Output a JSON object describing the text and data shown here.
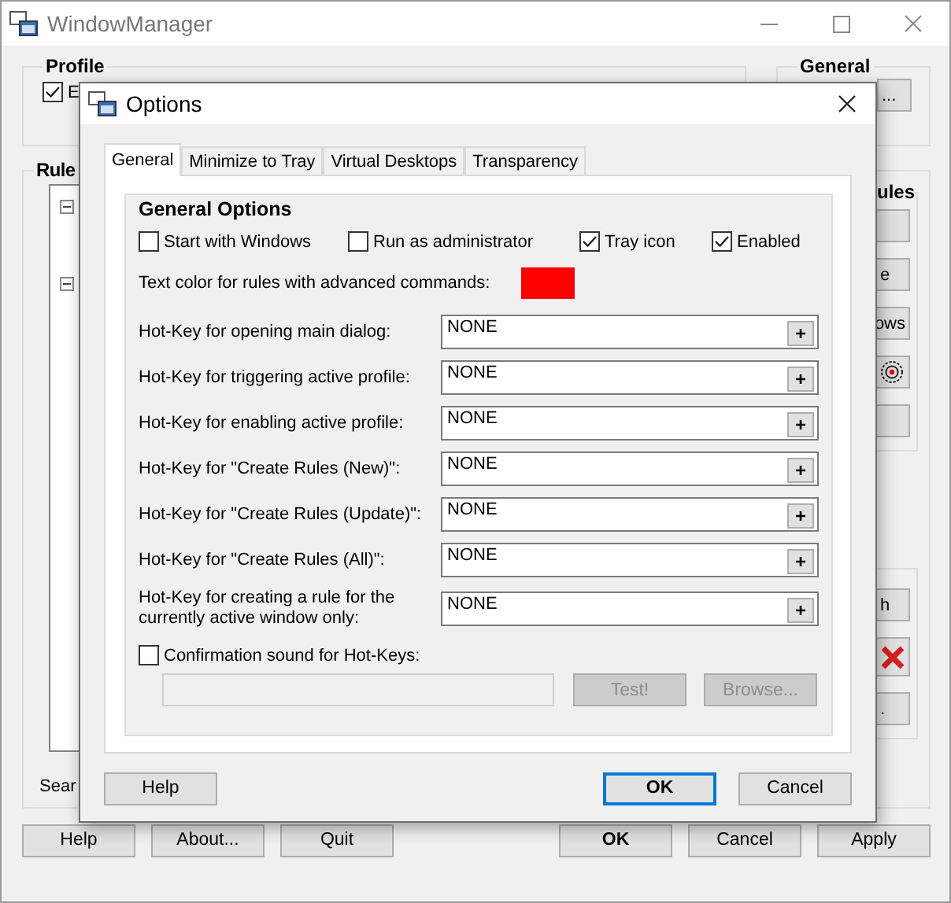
{
  "window": {
    "title": "WindowManager"
  },
  "profile": {
    "title": "Profile",
    "checkbox": {
      "label": "E",
      "checked": true
    }
  },
  "general": {
    "title": "General",
    "button": "..."
  },
  "rules": {
    "title": "Rule",
    "tree_nodes": [
      {
        "expanded": true
      },
      {
        "expanded": true
      }
    ],
    "search_label": "Sear",
    "panel_title": "ules",
    "buttons": [
      {
        "kind": "blank"
      },
      {
        "kind": "text",
        "label": "e"
      },
      {
        "kind": "text",
        "label": "ows"
      },
      {
        "kind": "target"
      },
      {
        "kind": "blank"
      }
    ],
    "buttons_2": [
      {
        "kind": "text",
        "label": "h"
      },
      {
        "kind": "delete"
      },
      {
        "kind": "text",
        "label": "."
      }
    ]
  },
  "footer_buttons": [
    {
      "label": "Help",
      "default": false
    },
    {
      "label": "About...",
      "default": false
    },
    {
      "label": "Quit",
      "default": false
    },
    {
      "label": "OK",
      "default": true
    },
    {
      "label": "Cancel",
      "default": false
    },
    {
      "label": "Apply",
      "default": false
    }
  ],
  "dialog": {
    "title": "Options",
    "tabs": [
      {
        "label": "General",
        "selected": true
      },
      {
        "label": "Minimize to Tray",
        "selected": false
      },
      {
        "label": "Virtual Desktops",
        "selected": false
      },
      {
        "label": "Transparency",
        "selected": false
      }
    ],
    "group_title": "General Options",
    "options": [
      {
        "label": "Start with Windows",
        "checked": false
      },
      {
        "label": "Run as administrator",
        "checked": false
      },
      {
        "label": "Tray icon",
        "checked": true
      },
      {
        "label": "Enabled",
        "checked": true
      }
    ],
    "color_setting": {
      "label": "Text color for rules with advanced commands:",
      "color": "#ff0000"
    },
    "hotkeys": [
      {
        "label": "Hot-Key for opening main dialog:",
        "value": "NONE",
        "button": "+"
      },
      {
        "label": "Hot-Key for triggering active profile:",
        "value": "NONE",
        "button": "+"
      },
      {
        "label": "Hot-Key for enabling active profile:",
        "value": "NONE",
        "button": "+"
      },
      {
        "label": "Hot-Key for \"Create Rules (New)\":",
        "value": "NONE",
        "button": "+"
      },
      {
        "label": "Hot-Key for \"Create Rules (Update)\":",
        "value": "NONE",
        "button": "+"
      },
      {
        "label": "Hot-Key for \"Create Rules (All)\":",
        "value": "NONE",
        "button": "+"
      },
      {
        "label": "Hot-Key for creating a rule for the currently active window only:",
        "value": "NONE",
        "button": "+"
      }
    ],
    "sound": {
      "label": "Confirmation sound for Hot-Keys:",
      "checked": false,
      "path_disabled": true,
      "buttons": [
        {
          "label": "Test!",
          "disabled": true
        },
        {
          "label": "Browse...",
          "disabled": true
        }
      ]
    },
    "buttons": [
      {
        "label": "Help",
        "default": false
      },
      {
        "label": "OK",
        "default": true
      },
      {
        "label": "Cancel",
        "default": false
      }
    ]
  }
}
